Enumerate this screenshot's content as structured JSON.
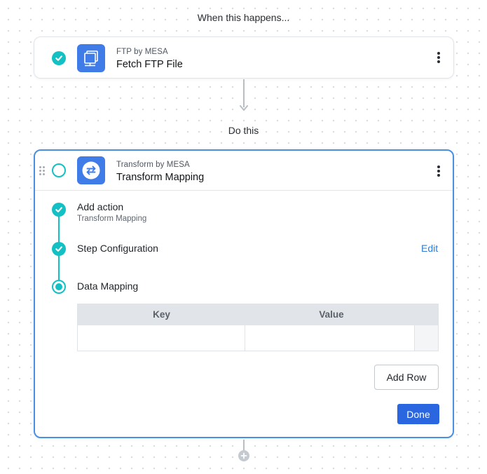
{
  "trigger": {
    "section_title": "When this happens...",
    "app_name": "FTP by MESA",
    "action_name": "Fetch FTP File",
    "status": "complete",
    "icon": "ftp-server-icon"
  },
  "action": {
    "section_title": "Do this",
    "app_name": "Transform by MESA",
    "action_name": "Transform Mapping",
    "status": "in-progress",
    "icon": "transform-arrows-icon",
    "steps": [
      {
        "label": "Add action",
        "sublabel": "Transform Mapping",
        "status": "complete"
      },
      {
        "label": "Step Configuration",
        "status": "complete",
        "link": "Edit"
      },
      {
        "label": "Data Mapping",
        "status": "active"
      }
    ],
    "mapping_table": {
      "columns": [
        "Key",
        "Value"
      ],
      "rows": [
        {
          "key": "",
          "value": ""
        }
      ]
    },
    "add_row_label": "Add Row",
    "done_label": "Done"
  },
  "colors": {
    "accent_teal": "#13c0c4",
    "app_icon_blue": "#3f7ce8",
    "selected_border": "#4a90e2",
    "primary_button": "#2a66e0",
    "link": "#2f7bd8"
  }
}
